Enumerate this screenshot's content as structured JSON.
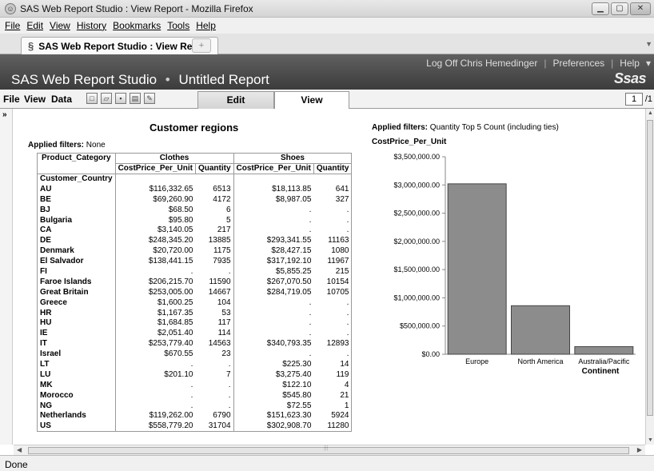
{
  "window": {
    "title": "SAS Web Report Studio : View Report - Mozilla Firefox",
    "controls": {
      "minimize": "▁",
      "maximize": "▢",
      "close": "✕"
    }
  },
  "browser_menu": [
    "File",
    "Edit",
    "View",
    "History",
    "Bookmarks",
    "Tools",
    "Help"
  ],
  "browser_tab": {
    "label": "SAS Web Report Studio : View Report",
    "new_tab": "+"
  },
  "sas_header": {
    "links": [
      "Log Off Chris Hemedinger",
      "Preferences",
      "Help"
    ],
    "app_name": "SAS Web Report Studio",
    "separator": "•",
    "report_name": "Untitled Report",
    "logo": "Ssas"
  },
  "app_menu": {
    "items": [
      "File",
      "View",
      "Data"
    ],
    "modes": {
      "edit": "Edit",
      "view": "View"
    },
    "page_current": "1",
    "page_total": "/1"
  },
  "table": {
    "title": "Customer regions",
    "applied_filters_label": "Applied filters:",
    "applied_filters_value": "None",
    "corner_label": "Product_Category",
    "row_header_label": "Customer_Country",
    "groups": [
      "Clothes",
      "Shoes"
    ],
    "measures": [
      "CostPrice_Per_Unit",
      "Quantity",
      "CostPrice_Per_Unit",
      "Quantity"
    ],
    "rows": [
      [
        "AU",
        "$116,332.65",
        "6513",
        "$18,113.85",
        "641"
      ],
      [
        "BE",
        "$69,260.90",
        "4172",
        "$8,987.05",
        "327"
      ],
      [
        "BJ",
        "$68.50",
        "6",
        ".",
        "."
      ],
      [
        "Bulgaria",
        "$95.80",
        "5",
        ".",
        "."
      ],
      [
        "CA",
        "$3,140.05",
        "217",
        ".",
        "."
      ],
      [
        "DE",
        "$248,345.20",
        "13885",
        "$293,341.55",
        "11163"
      ],
      [
        "Denmark",
        "$20,720.00",
        "1175",
        "$28,427.15",
        "1080"
      ],
      [
        "El Salvador",
        "$138,441.15",
        "7935",
        "$317,192.10",
        "11967"
      ],
      [
        "FI",
        ".",
        ".",
        "$5,855.25",
        "215"
      ],
      [
        "Faroe Islands",
        "$206,215.70",
        "11590",
        "$267,070.50",
        "10154"
      ],
      [
        "Great Britain",
        "$253,005.00",
        "14667",
        "$284,719.05",
        "10705"
      ],
      [
        "Greece",
        "$1,600.25",
        "104",
        ".",
        "."
      ],
      [
        "HR",
        "$1,167.35",
        "53",
        ".",
        "."
      ],
      [
        "HU",
        "$1,684.85",
        "117",
        ".",
        "."
      ],
      [
        "IE",
        "$2,051.40",
        "114",
        ".",
        "."
      ],
      [
        "IT",
        "$253,779.40",
        "14563",
        "$340,793.35",
        "12893"
      ],
      [
        "Israel",
        "$670.55",
        "23",
        ".",
        "."
      ],
      [
        "LT",
        ".",
        ".",
        "$225.30",
        "14"
      ],
      [
        "LU",
        "$201.10",
        "7",
        "$3,275.40",
        "119"
      ],
      [
        "MK",
        ".",
        ".",
        "$122.10",
        "4"
      ],
      [
        "Morocco",
        ".",
        ".",
        "$545.80",
        "21"
      ],
      [
        "NG",
        ".",
        ".",
        "$72.55",
        "1"
      ],
      [
        "Netherlands",
        "$119,262.00",
        "6790",
        "$151,623.30",
        "5924"
      ],
      [
        "US",
        "$558,779.20",
        "31704",
        "$302,908.70",
        "11280"
      ]
    ]
  },
  "chart_filters": {
    "label": "Applied filters:",
    "value": "Quantity Top 5 Count (including ties)"
  },
  "chart_data": {
    "type": "bar",
    "title": "",
    "ylabel": "CostPrice_Per_Unit",
    "xlabel": "Continent",
    "categories": [
      "Europe",
      "North America",
      "Australia/Pacific"
    ],
    "values": [
      3020000,
      860000,
      135000
    ],
    "ylim": [
      0,
      3500000
    ],
    "yticks": [
      0,
      500000,
      1000000,
      1500000,
      2000000,
      2500000,
      3000000,
      3500000
    ],
    "ytick_labels": [
      "$0.00",
      "$500,000.00",
      "$1,000,000.00",
      "$1,500,000.00",
      "$2,000,000.00",
      "$2,500,000.00",
      "$3,000,000.00",
      "$3,500,000.00"
    ],
    "grid": false,
    "bar_color": "#8c8c8c"
  },
  "status": "Done"
}
